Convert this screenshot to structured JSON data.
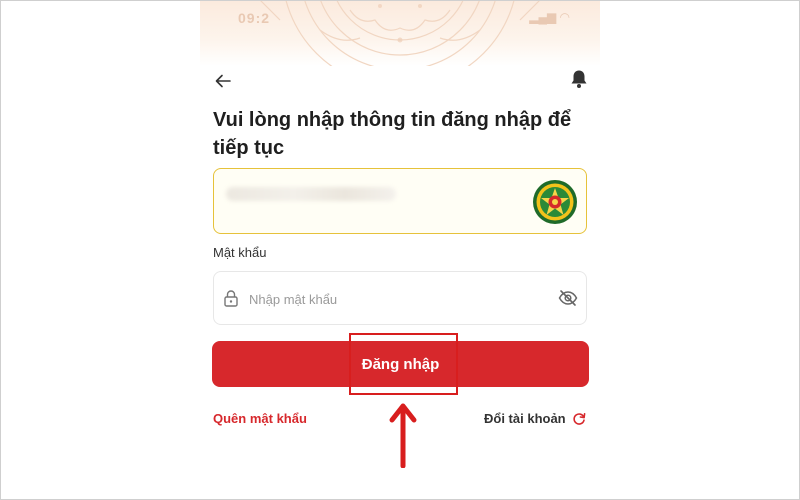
{
  "status_bar": {
    "time": "09:2",
    "icons_text": "▂▄▆ ◠"
  },
  "header": {
    "back_icon": "arrow-left-icon",
    "notification_icon": "bell-icon"
  },
  "title": "Vui lòng nhập thông tin đăng nhập để tiếp tục",
  "username_field": {
    "value_obscured": true,
    "emblem_icon": "police-emblem-icon"
  },
  "password": {
    "label": "Mật khẩu",
    "placeholder": "Nhập mật khẩu",
    "value": "",
    "lock_icon": "lock-icon",
    "visibility_icon": "eye-off-icon"
  },
  "login_button": {
    "label": "Đăng nhập"
  },
  "links": {
    "forgot_password": "Quên mật khẩu",
    "switch_account": "Đổi tài khoản",
    "switch_icon": "refresh-icon"
  },
  "colors": {
    "primary_red": "#d7282c",
    "field_highlight": "#e6c23a",
    "annotation_red": "#d81e1e"
  }
}
